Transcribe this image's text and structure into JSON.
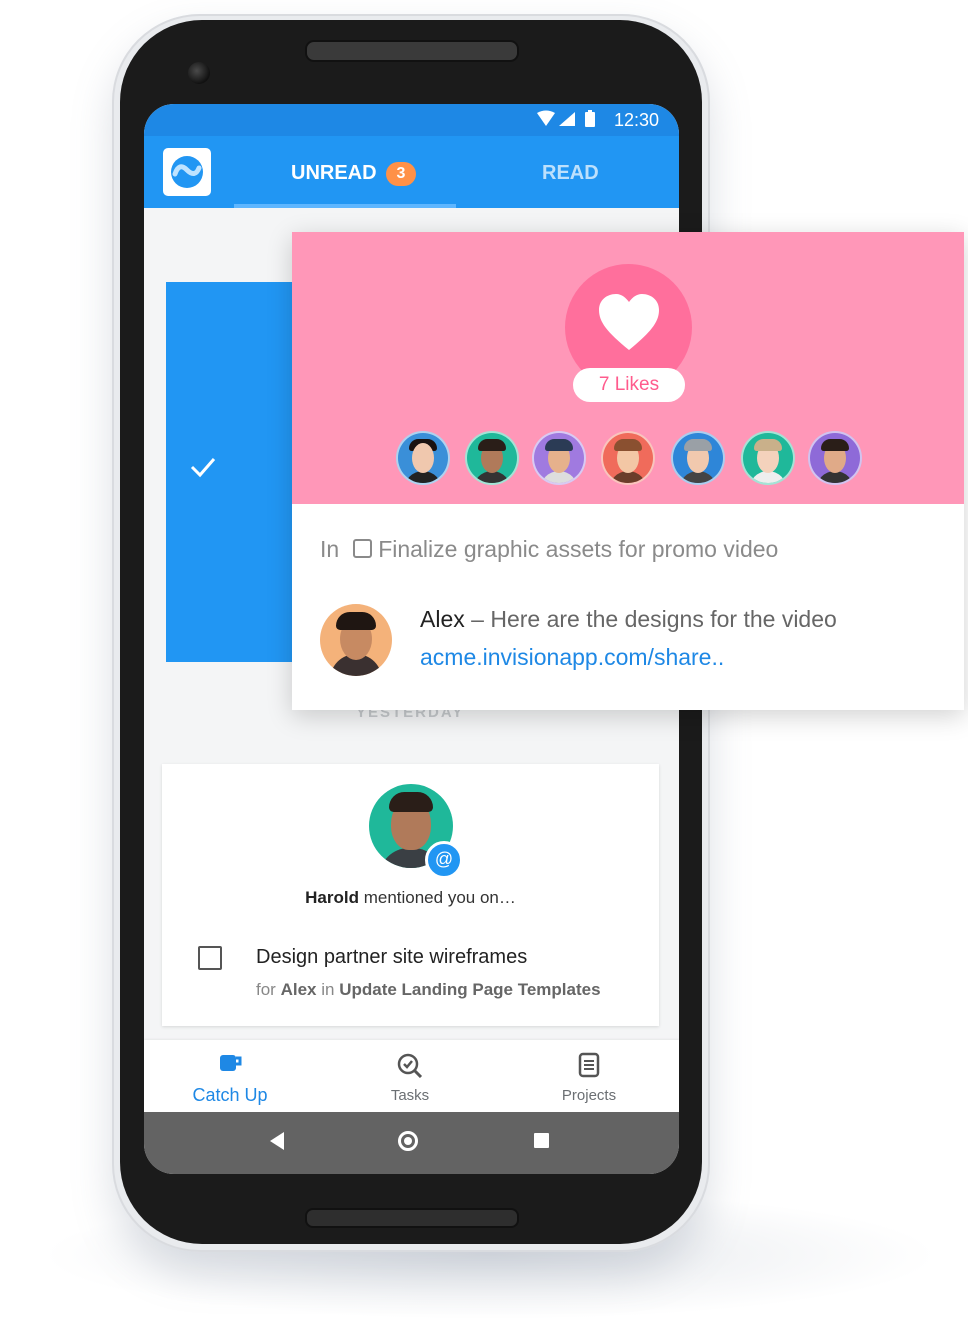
{
  "status": {
    "time": "12:30"
  },
  "tabs": {
    "unread": "UNREAD",
    "unread_count": "3",
    "read": "READ"
  },
  "feed": {
    "section_label": "YESTERDAY",
    "notification": {
      "actor": "Harold",
      "action": "mentioned you on…",
      "task_title": "Design partner site wireframes",
      "sub_prefix": "for",
      "sub_assignee": "Alex",
      "sub_in": "in",
      "sub_project": "Update Landing Page Templates"
    }
  },
  "bottom_nav": {
    "items": [
      {
        "label": "Catch Up",
        "icon": "cup-icon",
        "active": true
      },
      {
        "label": "Tasks",
        "icon": "check-search-icon",
        "active": false
      },
      {
        "label": "Projects",
        "icon": "document-icon",
        "active": false
      }
    ]
  },
  "popup": {
    "likes": "7 Likes",
    "in_prefix": "In",
    "task": "Finalize graphic assets for promo video",
    "comment_author": "Alex",
    "comment_sep": "–",
    "comment_text": "Here are the designs for the video",
    "comment_link": "acme.invisionapp.com/share.."
  },
  "colors": {
    "primary": "#2196f3",
    "badge": "#ff9147",
    "popup_bg": "#ff97b8",
    "heart_circle": "#ff6f9c",
    "link": "#1e88e5"
  }
}
